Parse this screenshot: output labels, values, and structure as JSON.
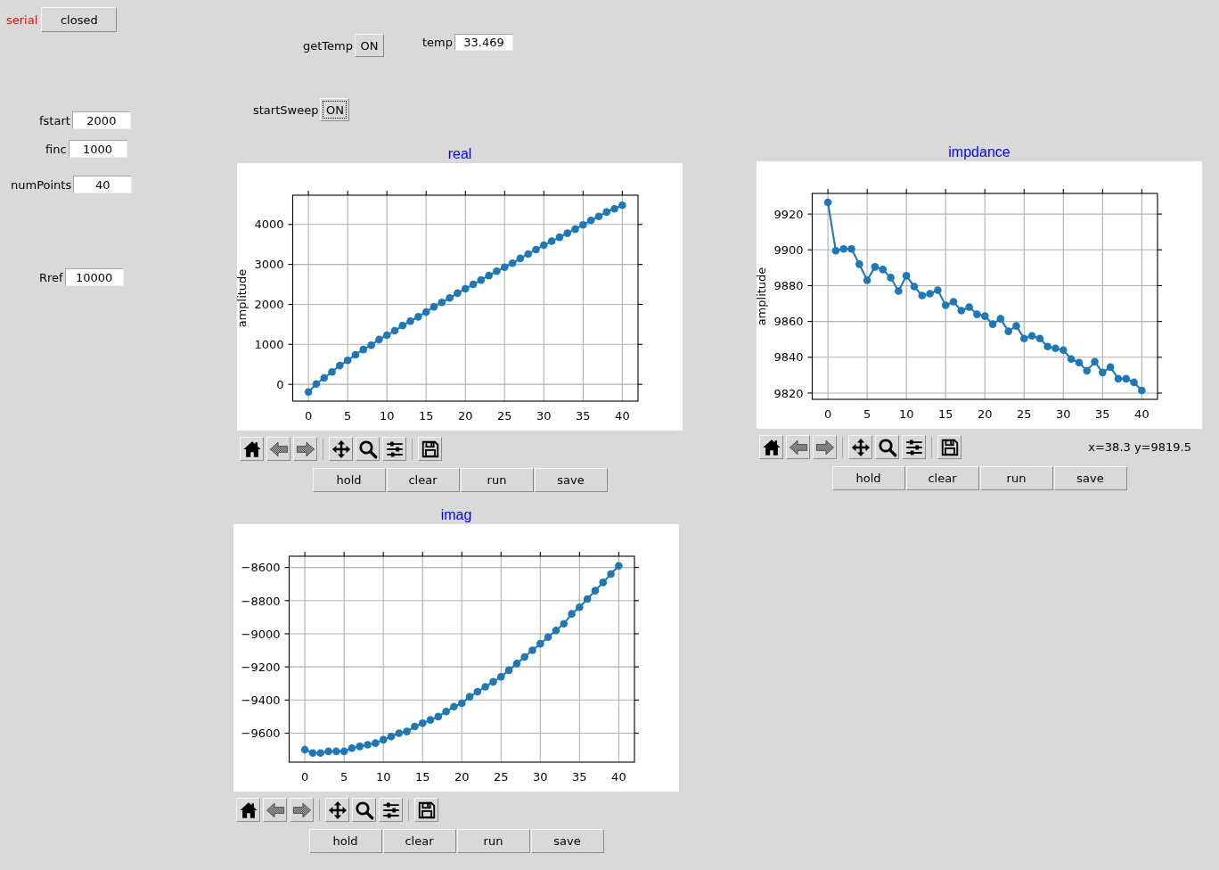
{
  "serial": {
    "label": "serial",
    "button": "closed"
  },
  "get_temp": {
    "label": "getTemp",
    "button": "ON",
    "focused": false
  },
  "temp": {
    "label": "temp",
    "value": "33.469"
  },
  "settings": [
    {
      "label": "fstart",
      "value": "2000"
    },
    {
      "label": "finc",
      "value": "1000"
    },
    {
      "label": "numPoints",
      "value": "40"
    },
    {
      "label": "Rref",
      "value": "10000"
    }
  ],
  "start_sweep": {
    "label": "startSweep",
    "button": "ON",
    "focused": true
  },
  "plots": [
    {
      "title": "real",
      "chart_data": {
        "type": "line",
        "marker": "o",
        "grid": true,
        "ylabel": "amplitude",
        "x": [
          0,
          1,
          2,
          3,
          4,
          5,
          6,
          7,
          8,
          9,
          10,
          11,
          12,
          13,
          14,
          15,
          16,
          17,
          18,
          19,
          20,
          21,
          22,
          23,
          24,
          25,
          26,
          27,
          28,
          29,
          30,
          31,
          32,
          33,
          34,
          35,
          36,
          37,
          38,
          39,
          40
        ],
        "values": [
          -190,
          10,
          160,
          310,
          470,
          600,
          740,
          870,
          980,
          1120,
          1230,
          1340,
          1470,
          1580,
          1690,
          1810,
          1940,
          2050,
          2160,
          2280,
          2390,
          2500,
          2610,
          2720,
          2830,
          2930,
          3030,
          3150,
          3260,
          3370,
          3480,
          3580,
          3680,
          3780,
          3880,
          3990,
          4100,
          4200,
          4310,
          4390,
          4480
        ],
        "xlim": [
          -2,
          42
        ],
        "ylim": [
          -420,
          4730
        ],
        "xticks": [
          0,
          5,
          10,
          15,
          20,
          25,
          30,
          35,
          40
        ],
        "yticks": [
          0,
          1000,
          2000,
          3000,
          4000
        ]
      },
      "buttons": [
        "hold",
        "clear",
        "run",
        "save"
      ]
    },
    {
      "title": "impdance",
      "chart_data": {
        "type": "line",
        "marker": "o",
        "grid": true,
        "ylabel": "amplitude",
        "x": [
          0,
          1,
          2,
          3,
          4,
          5,
          6,
          7,
          8,
          9,
          10,
          11,
          12,
          13,
          14,
          15,
          16,
          17,
          18,
          19,
          20,
          21,
          22,
          23,
          24,
          25,
          26,
          27,
          28,
          29,
          30,
          31,
          32,
          33,
          34,
          35,
          36,
          37,
          38,
          39,
          40
        ],
        "values": [
          9926.5,
          9899.5,
          9900.5,
          9900.5,
          9892,
          9883,
          9890.5,
          9889,
          9884.5,
          9877,
          9885.5,
          9879.5,
          9874.5,
          9875.5,
          9877.5,
          9869,
          9871,
          9866,
          9868,
          9864,
          9863,
          9858.5,
          9861.5,
          9854.5,
          9857.5,
          9850.5,
          9852,
          9850.5,
          9846,
          9845,
          9844,
          9839,
          9837,
          9832.5,
          9837.5,
          9831.5,
          9834.5,
          9828,
          9828,
          9826,
          9821.5
        ],
        "xlim": [
          -2,
          42
        ],
        "ylim": [
          9816.5,
          9931.5
        ],
        "xticks": [
          0,
          5,
          10,
          15,
          20,
          25,
          30,
          35,
          40
        ],
        "yticks": [
          9820,
          9840,
          9860,
          9880,
          9900,
          9920
        ]
      },
      "readout": "x=38.3 y=9819.5",
      "buttons": [
        "hold",
        "clear",
        "run",
        "save"
      ]
    },
    {
      "title": "imag",
      "chart_data": {
        "type": "line",
        "marker": "o",
        "grid": true,
        "x": [
          0,
          1,
          2,
          3,
          4,
          5,
          6,
          7,
          8,
          9,
          10,
          11,
          12,
          13,
          14,
          15,
          16,
          17,
          18,
          19,
          20,
          21,
          22,
          23,
          24,
          25,
          26,
          27,
          28,
          29,
          30,
          31,
          32,
          33,
          34,
          35,
          36,
          37,
          38,
          39,
          40
        ],
        "values": [
          -9700,
          -9720,
          -9720,
          -9710,
          -9710,
          -9710,
          -9690,
          -9680,
          -9670,
          -9660,
          -9640,
          -9620,
          -9600,
          -9590,
          -9560,
          -9540,
          -9520,
          -9500,
          -9470,
          -9440,
          -9420,
          -9380,
          -9350,
          -9320,
          -9290,
          -9260,
          -9220,
          -9180,
          -9140,
          -9100,
          -9060,
          -9020,
          -8980,
          -8940,
          -8880,
          -8840,
          -8790,
          -8740,
          -8690,
          -8640,
          -8590
        ],
        "xlim": [
          -2,
          42
        ],
        "ylim": [
          -9775,
          -8532
        ],
        "xticks": [
          0,
          5,
          10,
          15,
          20,
          25,
          30,
          35,
          40
        ],
        "yticks": [
          {
            "value": -9600,
            "label": "−9600"
          },
          {
            "value": -9400,
            "label": "−9400"
          },
          {
            "value": -9200,
            "label": "−9200"
          },
          {
            "value": -9000,
            "label": "−9000"
          },
          {
            "value": -8800,
            "label": "−8800"
          },
          {
            "value": -8600,
            "label": "−8600"
          }
        ]
      },
      "buttons": [
        "hold",
        "clear",
        "run",
        "save"
      ]
    }
  ]
}
